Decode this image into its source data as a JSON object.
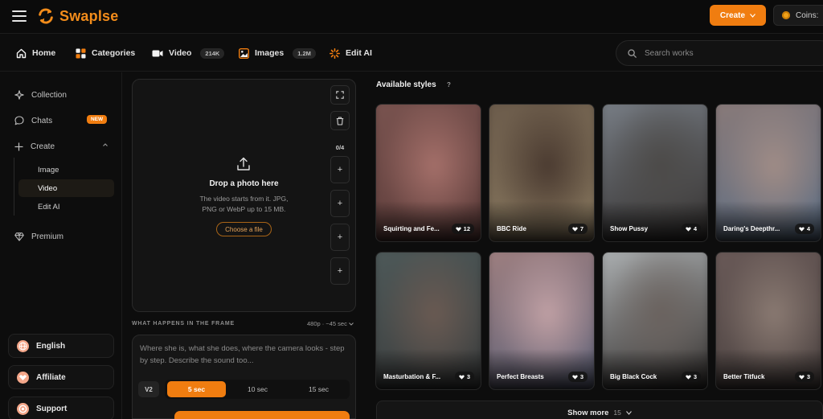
{
  "brand": {
    "name": "Swaplse",
    "accent": "#f07d10"
  },
  "topbar": {
    "create_label": "Create",
    "coins_label": "Coins:"
  },
  "nav": {
    "items": [
      {
        "label": "Home",
        "icon": "home-icon"
      },
      {
        "label": "Categories",
        "icon": "categories-icon"
      },
      {
        "label": "Video",
        "icon": "video-icon",
        "badge": "214K"
      },
      {
        "label": "Images",
        "icon": "image-icon",
        "badge": "1.2M"
      },
      {
        "label": "Edit AI",
        "icon": "sparkle-icon"
      }
    ],
    "search_placeholder": "Search works"
  },
  "sidebar": {
    "collection": "Collection",
    "chats": "Chats",
    "chats_badge": "NEW",
    "create": "Create",
    "create_sub": [
      "Image",
      "Video",
      "Edit AI"
    ],
    "premium": "Premium",
    "language": "English",
    "affiliate": "Affiliate",
    "support": "Support"
  },
  "upload": {
    "title": "Drop a photo here",
    "description": "The video starts from it. JPG, PNG or WebP up to 15 MB.",
    "choose_label": "Choose a file",
    "slots_count": "0/4",
    "slot_symbol": "+"
  },
  "prompt": {
    "section_label": "WHAT HAPPENS IN THE FRAME",
    "quality": "480p · ~45 sec",
    "placeholder": "Where she is, what she does, where the camera looks - step by step. Describe the sound too...",
    "model": "V2",
    "durations": [
      "5 sec",
      "10 sec",
      "15 sec"
    ],
    "active_duration": "5 sec"
  },
  "styles": {
    "title": "Available styles",
    "help": "?",
    "cards": [
      {
        "name": "Squirting and Fe...",
        "likes": "12",
        "colors": [
          "#7a5450",
          "#a5706a",
          "#5a3a38"
        ]
      },
      {
        "name": "BBC Ride",
        "likes": "7",
        "colors": [
          "#6a5a4a",
          "#4a3a30",
          "#8a7a60"
        ]
      },
      {
        "name": "Show Pussy",
        "likes": "4",
        "colors": [
          "#7a8088",
          "#4c4a48",
          "#2e2a28"
        ]
      },
      {
        "name": "Daring's Deepthr...",
        "likes": "4",
        "colors": [
          "#8a7a78",
          "#a08c86",
          "#5a6e86"
        ]
      },
      {
        "name": "Masturbation & F...",
        "likes": "3",
        "colors": [
          "#4e5a5a",
          "#6a5a52",
          "#3a3a3a"
        ]
      },
      {
        "name": "Perfect Breasts",
        "likes": "3",
        "colors": [
          "#a08080",
          "#c0a0a4",
          "#5a6078"
        ]
      },
      {
        "name": "Big Black Cock",
        "likes": "3",
        "colors": [
          "#b0b4b6",
          "#6a625e",
          "#2a2624"
        ]
      },
      {
        "name": "Better Titfuck",
        "likes": "3",
        "colors": [
          "#6a5a58",
          "#8a7a72",
          "#4a4240"
        ]
      }
    ],
    "show_more_label": "Show more",
    "show_more_count": "15"
  }
}
